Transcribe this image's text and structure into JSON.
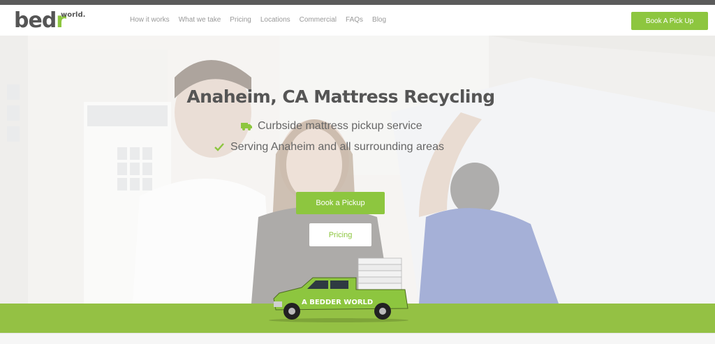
{
  "logo": {
    "brand_main": "bed",
    "brand_accent": "r",
    "brand_sup": "world."
  },
  "nav": {
    "links": [
      "How it works",
      "What we take",
      "Pricing",
      "Locations",
      "Commercial",
      "FAQs",
      "Blog"
    ],
    "cta_label": "Book A Pick Up"
  },
  "hero": {
    "title": "Anaheim, CA Mattress Recycling",
    "features": [
      {
        "icon": "truck-icon",
        "text": "Curbside mattress pickup service"
      },
      {
        "icon": "check-icon",
        "text": "Serving Anaheim and all surrounding areas"
      }
    ],
    "primary_button": "Book a Pickup",
    "secondary_button": "Pricing"
  },
  "truck": {
    "side_text": "A BEDDER WORLD"
  },
  "colors": {
    "accent": "#8dc63f",
    "band": "#94c144",
    "title": "#555555",
    "text": "#666666"
  }
}
